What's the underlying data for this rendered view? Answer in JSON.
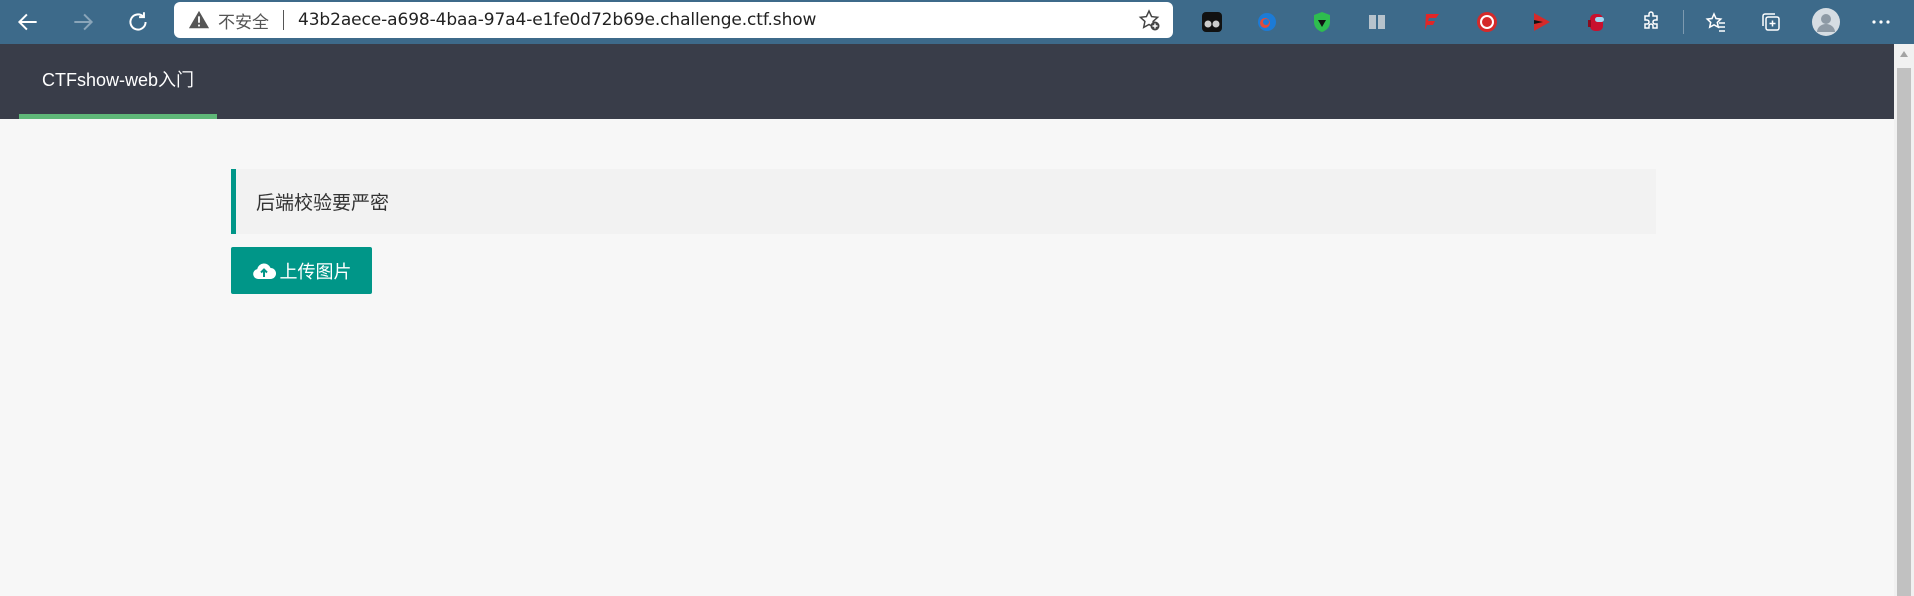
{
  "browser": {
    "insecure_label": "不安全",
    "url": "43b2aece-a698-4baa-97a4-e1fe0d72b69e.challenge.ctf.show",
    "colors": {
      "toolbar": "#3d6a8a",
      "address_bg": "#ffffff"
    }
  },
  "page": {
    "site_title": "CTFshow-web入门",
    "notice_text": "后端校验要严密",
    "upload_button_label": "上传图片",
    "colors": {
      "header_bg": "#393d49",
      "accent": "#009688",
      "active_tab": "#5fb878"
    }
  }
}
